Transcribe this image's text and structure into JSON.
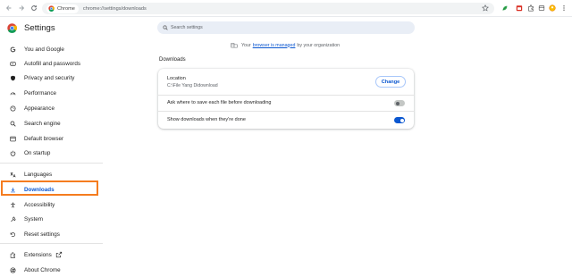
{
  "browser": {
    "chip_label": "Chrome",
    "url": "chrome://settings/downloads"
  },
  "sidebar": {
    "title": "Settings",
    "items": [
      {
        "label": "You and Google",
        "icon": "google-g-icon"
      },
      {
        "label": "Autofill and passwords",
        "icon": "key-icon"
      },
      {
        "label": "Privacy and security",
        "icon": "shield-icon"
      },
      {
        "label": "Performance",
        "icon": "speedometer-icon"
      },
      {
        "label": "Appearance",
        "icon": "palette-icon"
      },
      {
        "label": "Search engine",
        "icon": "search-icon"
      },
      {
        "label": "Default browser",
        "icon": "browser-window-icon"
      },
      {
        "label": "On startup",
        "icon": "power-icon"
      },
      {
        "label": "Languages",
        "icon": "translate-icon"
      },
      {
        "label": "Downloads",
        "icon": "download-icon",
        "active": true
      },
      {
        "label": "Accessibility",
        "icon": "accessibility-icon"
      },
      {
        "label": "System",
        "icon": "wrench-icon"
      },
      {
        "label": "Reset settings",
        "icon": "reset-icon"
      },
      {
        "label": "Extensions",
        "icon": "puzzle-icon"
      },
      {
        "label": "About Chrome",
        "icon": "chrome-logo-icon"
      }
    ]
  },
  "search": {
    "placeholder": "Search settings"
  },
  "managed": {
    "prefix": "Your",
    "link": "browser is managed",
    "suffix": "by your organization"
  },
  "downloads": {
    "section_title": "Downloads",
    "location_label": "Location",
    "location_value": "C:\\File Yang Didownload",
    "change_label": "Change",
    "ask_label": "Ask where to save each file before downloading",
    "ask_enabled": false,
    "show_label": "Show downloads when they're done",
    "show_enabled": true
  },
  "colors": {
    "accent": "#0b57d0",
    "highlight": "#f57c1f"
  }
}
